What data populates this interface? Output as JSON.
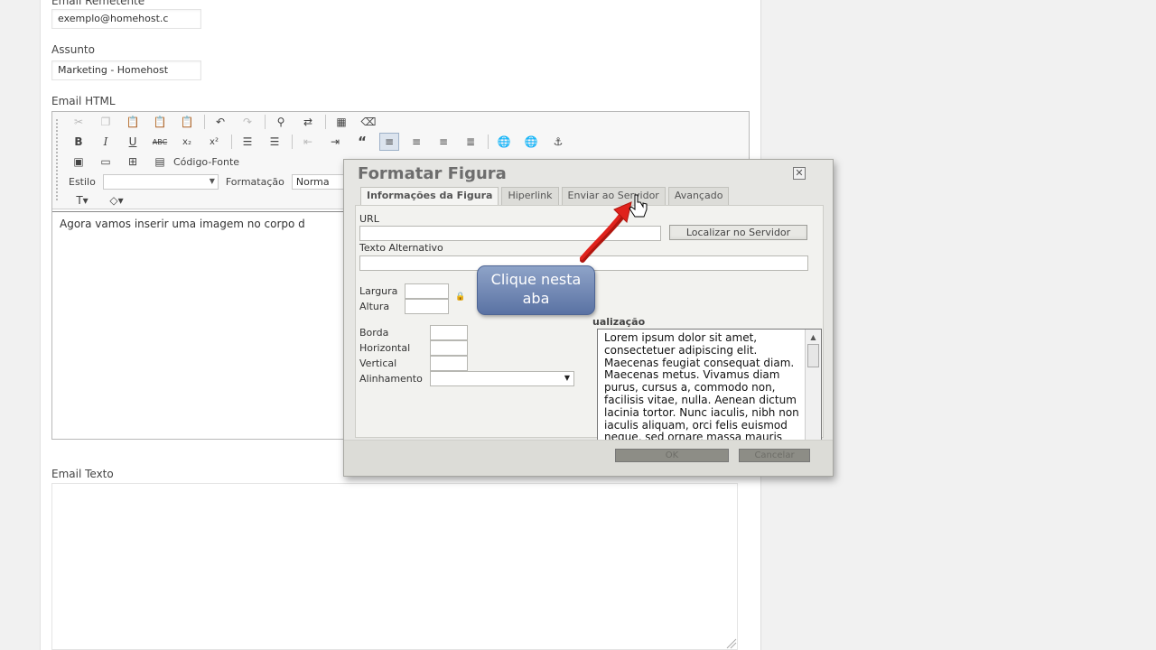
{
  "form": {
    "sender_label": "Email Remetente",
    "sender_value": "exemplo@homehost.c",
    "subject_label": "Assunto",
    "subject_value": "Marketing - Homehost",
    "html_label": "Email HTML",
    "text_label": "Email Texto"
  },
  "editor": {
    "source_label": "Código-Fonte",
    "style_label": "Estilo",
    "format_label": "Formatação",
    "format_value": "Norma",
    "body_text": "Agora vamos inserir uma imagem no corpo d"
  },
  "dialog": {
    "title": "Formatar Figura",
    "close": "✕",
    "tabs": [
      "Informações da Figura",
      "Hiperlink",
      "Enviar ao Servidor",
      "Avançado"
    ],
    "url_label": "URL",
    "browse_button": "Localizar no Servidor",
    "alt_label": "Texto Alternativo",
    "width_label": "Largura",
    "height_label": "Altura",
    "border_label": "Borda",
    "hspace_label": "Horizontal",
    "vspace_label": "Vertical",
    "align_label": "Alinhamento",
    "preview_label": "ualização",
    "preview_text": "Lorem ipsum dolor sit amet, consectetuer adipiscing elit. Maecenas feugiat consequat diam. Maecenas metus. Vivamus diam purus, cursus a, commodo non, facilisis vitae, nulla. Aenean dictum lacinia tortor. Nunc iaculis, nibh non iaculis aliquam, orci felis euismod neque, sed ornare massa mauris sed",
    "ok_button": "OK",
    "cancel_button": "Cancelar"
  },
  "callout": {
    "line1": "Clique nesta",
    "line2": "aba"
  },
  "colors": {
    "callout": "#6e84b3",
    "arrow": "#e0221c"
  }
}
